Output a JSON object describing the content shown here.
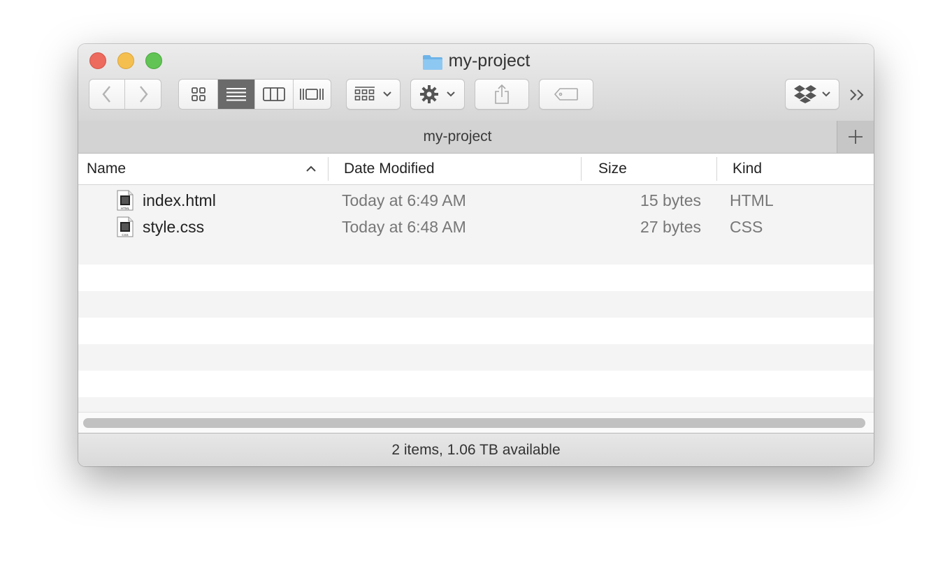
{
  "window": {
    "title": "my-project"
  },
  "toolbar": {
    "back": "back",
    "forward": "forward",
    "view_modes": [
      "icon-view",
      "list-view",
      "column-view",
      "cover-flow-view"
    ],
    "active_view": "list-view",
    "arrange": "arrange",
    "action": "action",
    "share": "share",
    "tags": "tags",
    "dropbox": "dropbox",
    "overflow": "»"
  },
  "pathbar": {
    "label": "my-project",
    "add_tab": "+"
  },
  "columns": {
    "name": "Name",
    "date_modified": "Date Modified",
    "size": "Size",
    "kind": "Kind",
    "sort_indicator": "^"
  },
  "files": [
    {
      "name": "index.html",
      "date": "Today at 6:49 AM",
      "size": "15 bytes",
      "kind": "HTML",
      "icon_label": "HTML"
    },
    {
      "name": "style.css",
      "date": "Today at 6:48 AM",
      "size": "27 bytes",
      "kind": "CSS",
      "icon_label": "CSS"
    }
  ],
  "status": {
    "text": "2 items, 1.06 TB available"
  },
  "colors": {
    "close": "#ed6a5e",
    "minimize": "#f5bf4f",
    "zoom": "#61c454",
    "active_segment": "#6a6a6a",
    "folder": "#6db3e8"
  }
}
